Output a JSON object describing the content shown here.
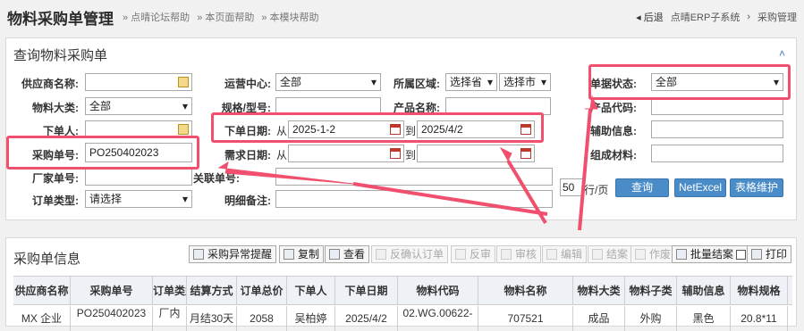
{
  "header": {
    "title": "物料采购单管理",
    "help_forum": "» 点晴论坛帮助",
    "help_page": "» 本页面帮助",
    "help_module": "» 本模块帮助",
    "back": "◂ 后退",
    "breadcrumb": [
      "点晴ERP子系统",
      "›",
      "采购管理"
    ]
  },
  "query": {
    "title": "查询物料采购单",
    "labels": {
      "supplier": "供应商名称:",
      "ops_center": "运营中心:",
      "region": "所属区域:",
      "doc_status": "单据状态:",
      "material_class": "物料大类:",
      "spec": "规格/型号:",
      "product_name": "产品名称:",
      "product_code": "产品代码:",
      "orderer": "下单人:",
      "order_date": "下单日期:",
      "aux_info": "辅助信息:",
      "po_no": "采购单号:",
      "need_date": "需求日期:",
      "component": "组成材料:",
      "mfr_no": "厂家单号:",
      "related_order": "关联单号:",
      "order_type": "订单类型:",
      "remark": "明细备注:"
    },
    "values": {
      "ops_center": "全部",
      "province": "选择省",
      "city": "选择市",
      "doc_status": "全部",
      "material_class": "全部",
      "po_no": "PO250402023",
      "order_date_from": "2025-1-2",
      "order_date_to": "2025/4/2",
      "order_type": "请选择",
      "page_size": "50"
    },
    "from": "从",
    "to": "到",
    "per_page": "行/页",
    "buttons": {
      "search": "查询",
      "net_excel": "NetExcel",
      "maintain": "表格维护"
    }
  },
  "orders": {
    "title": "采购单信息",
    "toolbar": [
      "采购异常提醒",
      "复制",
      "查看",
      "反确认订单",
      "反审",
      "审核",
      "编辑",
      "结案",
      "作废",
      "批量结案",
      "打印"
    ],
    "columns": [
      "供应商名称",
      "采购单号",
      "订单类型",
      "结算方式",
      "订单总价",
      "下单人",
      "下单日期",
      "物料代码",
      "物料名称",
      "物料大类",
      "物料子类",
      "辅助信息",
      "物料规格"
    ],
    "row": [
      "MX 企业",
      "PO250402023",
      "厂内",
      "月结30天",
      "2058",
      "吴柏婷",
      "2025/4/2",
      "02.WG.00622-",
      "707521",
      "成品",
      "外购",
      "黑色",
      "20.8*11"
    ]
  },
  "colors": {
    "highlight": "#f0506e",
    "accent": "#4a8cc7"
  }
}
